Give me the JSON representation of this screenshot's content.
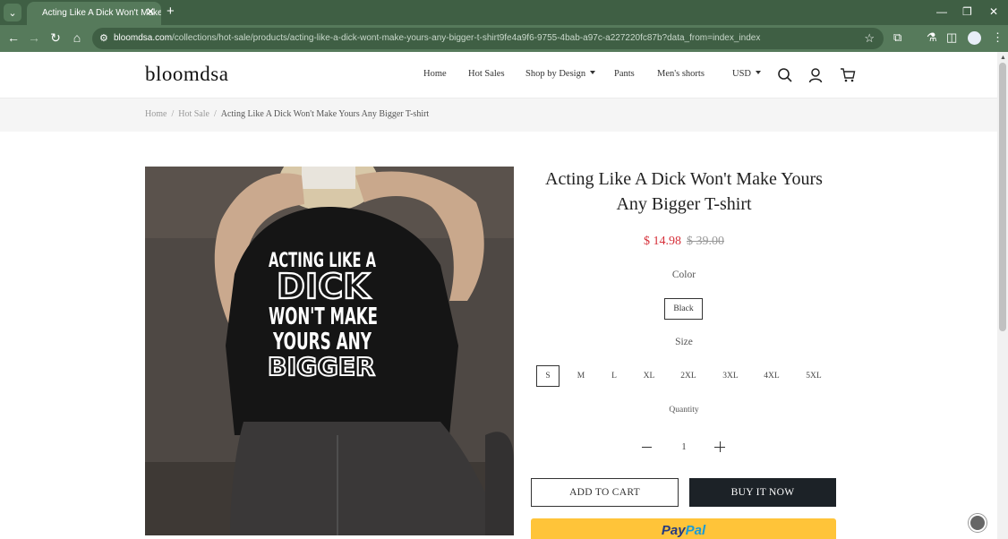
{
  "browser": {
    "tab_title": "Acting Like A Dick Won't Make",
    "url_domain": "bloomdsa.com",
    "url_path": "/collections/hot-sale/products/acting-like-a-dick-wont-make-yours-any-bigger-t-shirt9fe4a9f6-9755-4bab-a97c-a227220fc87b?data_from=index_index"
  },
  "header": {
    "logo": "bloomdsa",
    "nav": [
      "Home",
      "Hot Sales",
      "Shop by Design",
      "Pants",
      "Men's shorts"
    ],
    "currency": "USD"
  },
  "breadcrumb": [
    "Home",
    "Hot Sale",
    "Acting Like A Dick Won't Make Yours Any Bigger T-shirt"
  ],
  "product": {
    "title": "Acting Like A Dick Won't Make Yours Any Bigger T-shirt",
    "sale_price": "$ 14.98",
    "compare_price": "$ 39.00",
    "color_label": "Color",
    "color_value": "Black",
    "size_label": "Size",
    "sizes": [
      "S",
      "M",
      "L",
      "XL",
      "2XL",
      "3XL",
      "4XL",
      "5XL"
    ],
    "selected_size": "S",
    "quantity_label": "Quantity",
    "quantity": "1",
    "add_to_cart": "ADD TO CART",
    "buy_now": "BUY IT NOW",
    "paypal_p1": "Pay",
    "paypal_p2": "Pal",
    "shirt_print": [
      "ACTING LIKE A",
      "DICK",
      "WON'T MAKE",
      "YOURS ANY",
      "BIGGER"
    ]
  },
  "colors": {
    "browser_dark": "#3f5f44",
    "browser_light": "#567a5b",
    "sale_red": "#d6303a",
    "buy_button": "#1c2227",
    "paypal_yellow": "#ffc439"
  }
}
